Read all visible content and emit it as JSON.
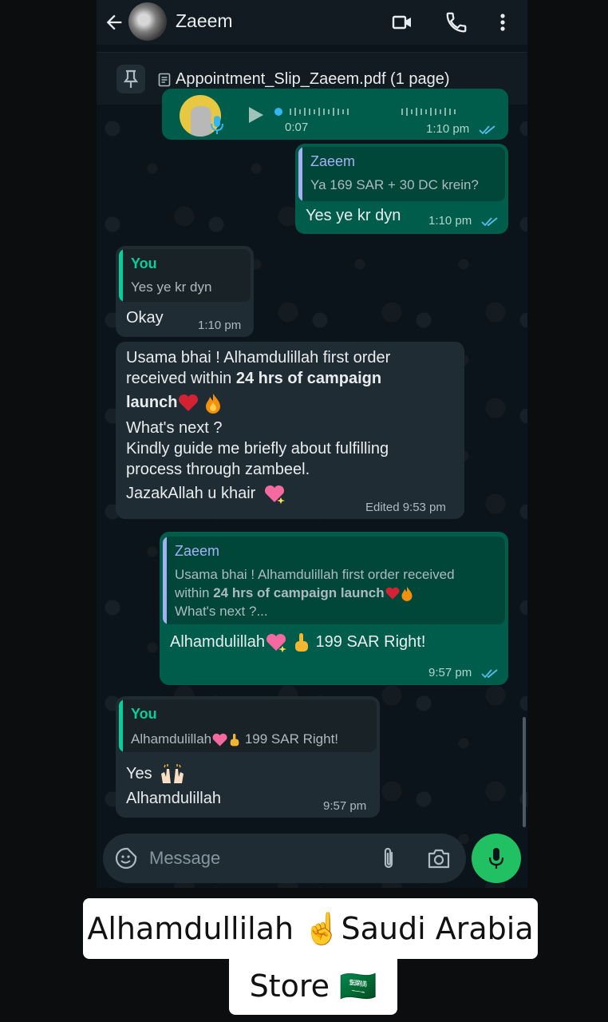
{
  "header": {
    "contact_name": "Zaeem",
    "icons": [
      "back-arrow-icon",
      "video-call-icon",
      "phone-call-icon",
      "more-vertical-icon"
    ]
  },
  "pinned": {
    "document_name": "Appointment_Slip_Zaeem.pdf (1 page)"
  },
  "messages": {
    "voice_note": {
      "duration": "0:07",
      "time": "1:10 pm"
    },
    "m1": {
      "quote_author": "Zaeem",
      "quote_text": "Ya 169 SAR + 30 DC krein?",
      "text": "Yes ye kr dyn",
      "time": "1:10 pm"
    },
    "m2": {
      "quote_author": "You",
      "quote_text": "Yes ye kr dyn",
      "text": "Okay",
      "time": "1:10 pm"
    },
    "m3": {
      "line1": "Usama bhai ! Alhamdulillah first order",
      "line2_pre": "received within ",
      "line2_bold": "24 hrs of campaign",
      "line3_bold": "launch",
      "line4": "What's next ?",
      "line5": "Kindly guide me briefly about fulfilling",
      "line6": "process through zambeel.",
      "line7": "JazakAllah u khair",
      "edited_time": "Edited 9:53 pm"
    },
    "m4": {
      "quote_author": "Zaeem",
      "quote_line1": "Usama bhai ! Alhamdulillah first order received",
      "quote_line2_pre": "within ",
      "quote_line2_bold": "24 hrs of campaign launch",
      "quote_line3": "What's next ?...",
      "text_pre": "Alhamdulillah",
      "text_post": " 199 SAR Right!",
      "time": "9:57 pm"
    },
    "m5": {
      "quote_author": "You",
      "quote_text_pre": "Alhamdulillah",
      "quote_text_post": " 199 SAR Right!",
      "line1": "Yes",
      "line2": "Alhamdulillah",
      "time": "9:57 pm"
    }
  },
  "input": {
    "placeholder": "Message"
  },
  "colors": {
    "outgoing_bubble": "#005c4b",
    "incoming_bubble": "#202c33",
    "read_ticks": "#53bdeb",
    "mic_button": "#21c063"
  },
  "caption": {
    "line1": "Alhamdullilah ☝️Saudi Arabia",
    "line2": "Store 🇸🇦"
  }
}
